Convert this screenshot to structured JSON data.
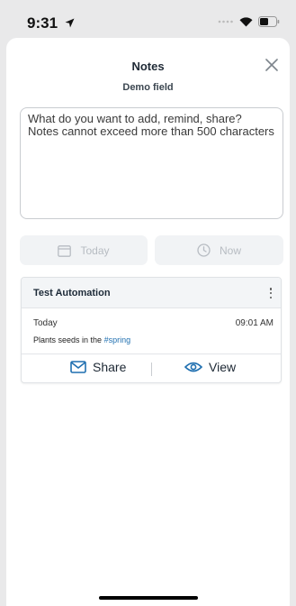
{
  "status_bar": {
    "time": "9:31"
  },
  "sheet": {
    "title": "Notes",
    "subtitle": "Demo field",
    "input": {
      "value": "",
      "placeholder": "What do you want to add, remind, share? Notes cannot exceed more than 500 characters"
    },
    "date_button": {
      "label": "Today",
      "icon": "calendar-icon"
    },
    "time_button": {
      "label": "Now",
      "icon": "clock-icon"
    }
  },
  "note_card": {
    "title": "Test Automation",
    "date": "Today",
    "time": "09:01 AM",
    "text_prefix": "Plants seeds in the ",
    "hashtag": "#spring",
    "share_label": "Share",
    "view_label": "View"
  },
  "colors": {
    "accent_blue": "#1f6fb0",
    "muted": "#b7bcc2"
  }
}
